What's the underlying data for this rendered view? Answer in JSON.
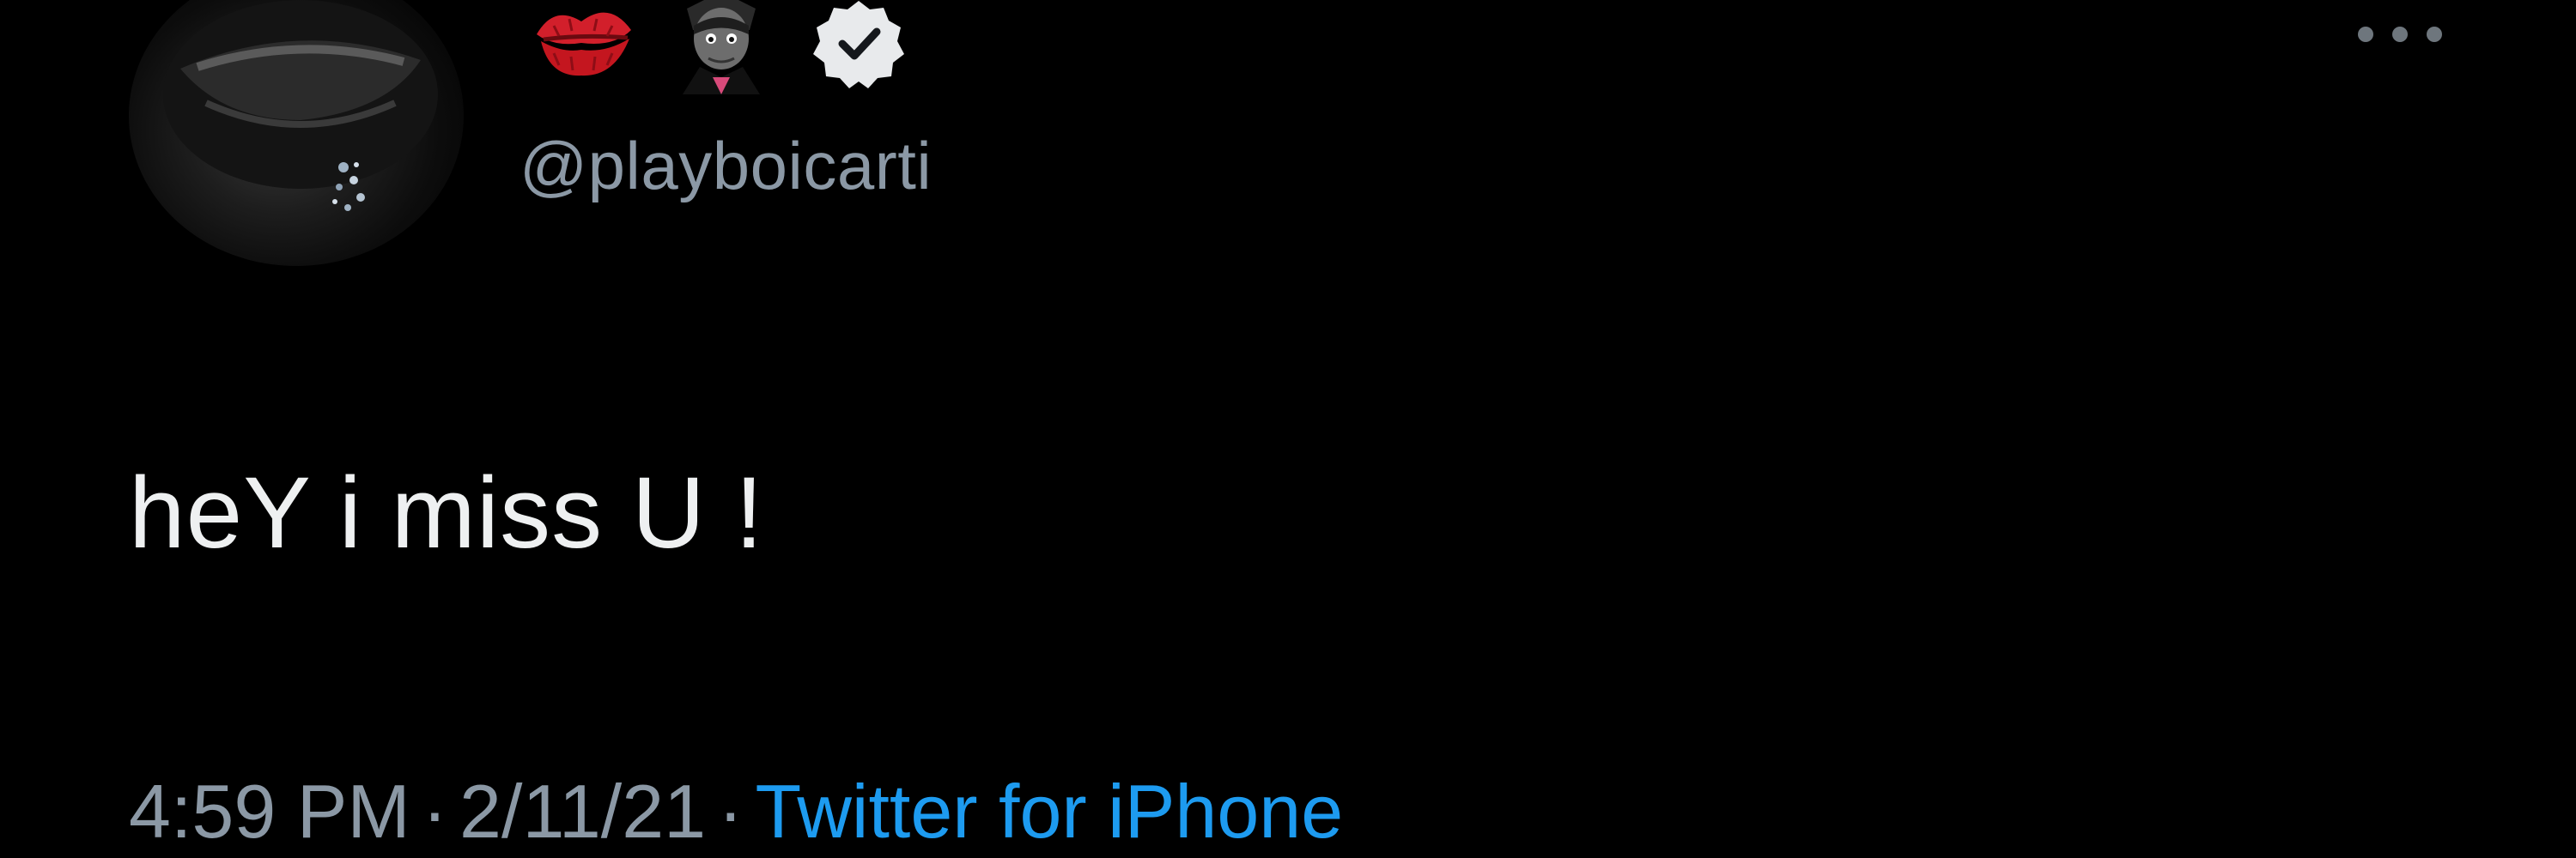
{
  "tweet": {
    "handle": "@playboicarti",
    "emojis": [
      "kiss-mark-icon",
      "vampire-icon"
    ],
    "verified": true,
    "body": "heY i miss U !",
    "time": "4:59 PM",
    "date": "2/11/21",
    "separator": "·",
    "source": "Twitter for iPhone"
  },
  "colors": {
    "background": "#000000",
    "text": "#e7e9ea",
    "secondary": "#8b98a5",
    "link": "#1d9bf0",
    "kiss": "#d21f2b"
  }
}
